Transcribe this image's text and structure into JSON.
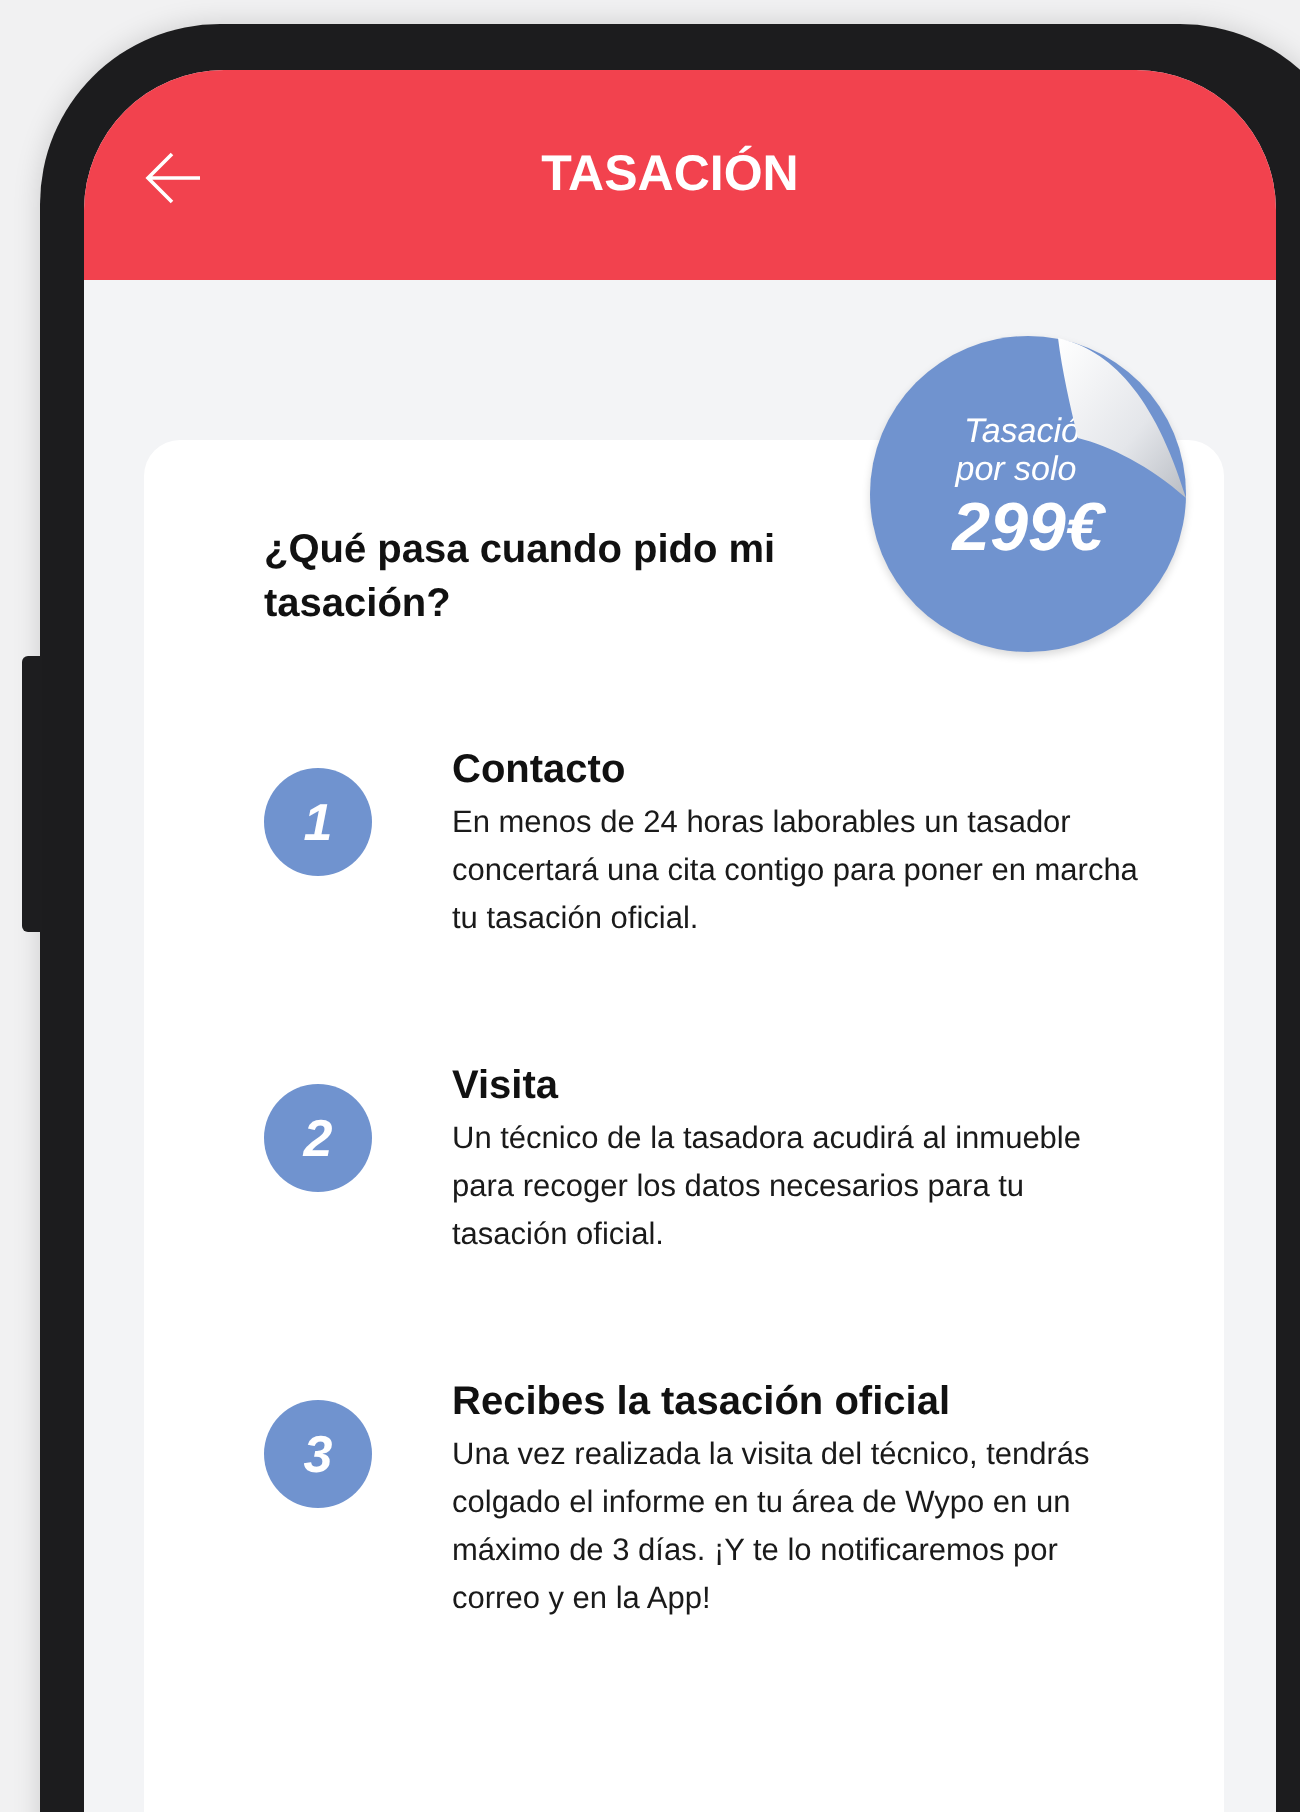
{
  "header": {
    "title": "TASACIÓN"
  },
  "badge": {
    "line_1": "Tasació",
    "line_2": "por solo",
    "price": "299€"
  },
  "card": {
    "heading": "¿Qué pasa cuando pido mi tasación?",
    "steps": [
      {
        "number": "1",
        "title": "Contacto",
        "text": "En menos de 24 horas laborables un tasador concertará una cita contigo para poner en marcha tu tasación oficial."
      },
      {
        "number": "2",
        "title": "Visita",
        "text": "Un técnico de la tasadora acudirá al inmueble para recoger los datos necesarios para tu tasación oficial."
      },
      {
        "number": "3",
        "title": "Recibes la tasación oficial",
        "text": "Una vez realizada la visita del técnico, tendrás colgado el informe en tu área de Wypo en un máximo de 3 días. ¡Y te lo notificaremos por correo y en la App!"
      }
    ]
  }
}
